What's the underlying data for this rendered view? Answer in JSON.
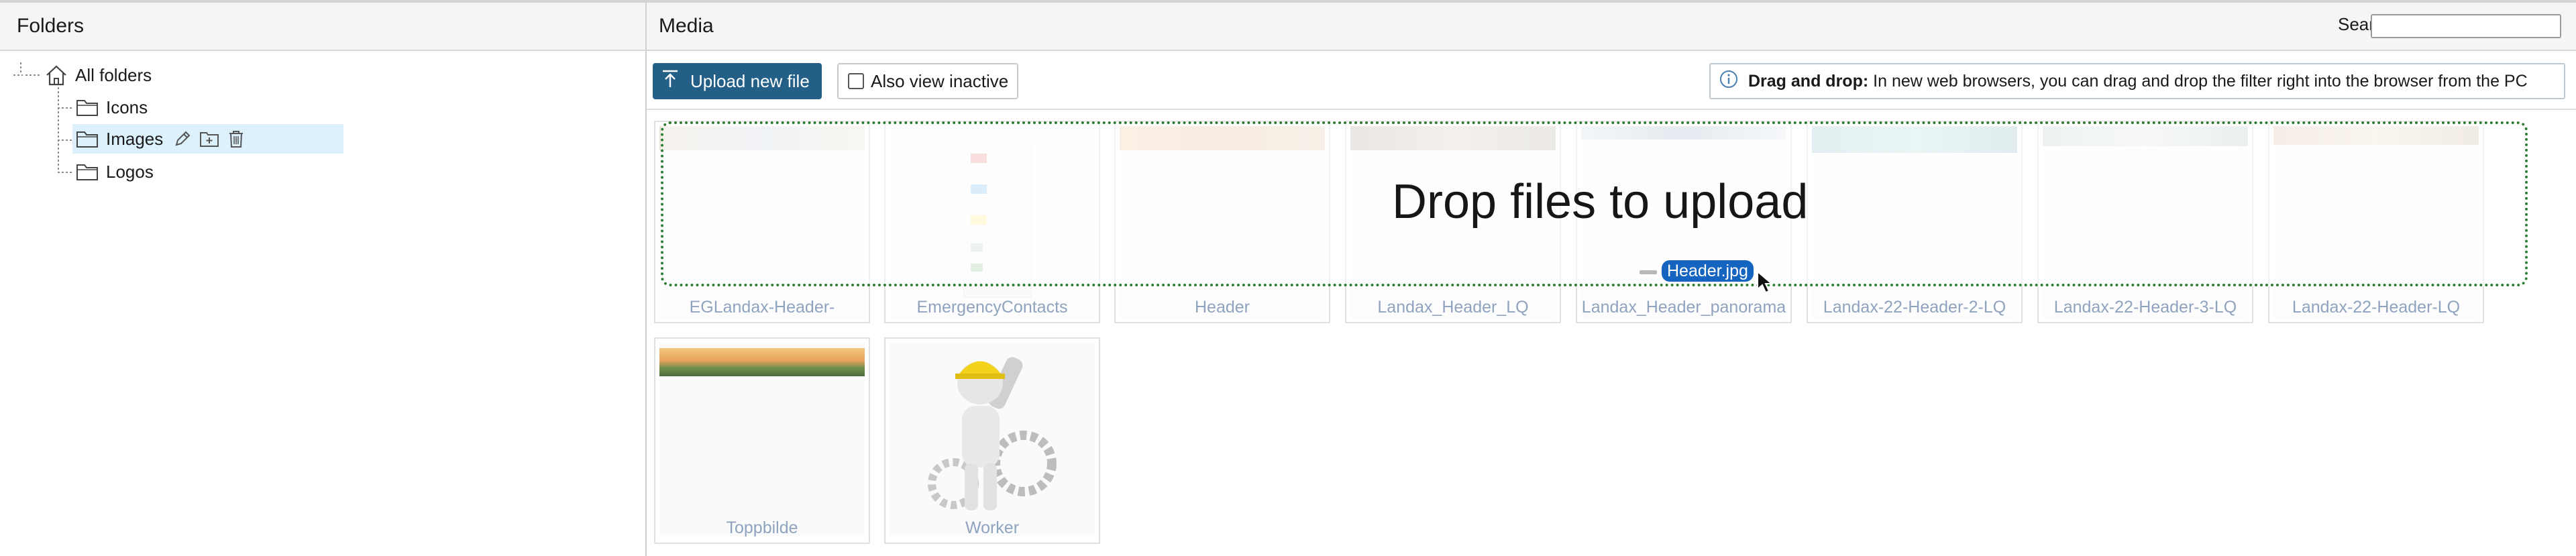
{
  "folders_panel": {
    "title": "Folders",
    "tree": [
      {
        "label": "All folders",
        "icon": "home-icon"
      },
      {
        "label": "Icons",
        "icon": "folder-icon"
      },
      {
        "label": "Images",
        "icon": "folder-icon",
        "selected": true,
        "actions": [
          "edit-icon",
          "add-folder-icon",
          "delete-icon"
        ]
      },
      {
        "label": "Logos",
        "icon": "folder-icon"
      }
    ]
  },
  "media_panel": {
    "title": "Media",
    "search": {
      "label": "Search",
      "value": "",
      "placeholder": ""
    },
    "toolbar": {
      "upload_label": "Upload new file",
      "inactive_label": "Also view inactive",
      "inactive_checked": false,
      "info_bold": "Drag and drop:",
      "info_text": "In new web browsers, you can drag and drop the filter right into the browser from the PC"
    },
    "dropzone": {
      "text": "Drop files to upload",
      "dragged_file": "Header.jpg"
    },
    "thumbnails": [
      {
        "caption": "EGLandax-Header-"
      },
      {
        "caption": "EmergencyContacts"
      },
      {
        "caption": "Header"
      },
      {
        "caption": "Landax_Header_LQ"
      },
      {
        "caption": "Landax_Header_panorama"
      },
      {
        "caption": "Landax-22-Header-2-LQ"
      },
      {
        "caption": "Landax-22-Header-3-LQ"
      },
      {
        "caption": "Landax-22-Header-LQ"
      },
      {
        "caption": "Toppbilde"
      },
      {
        "caption": "Worker"
      }
    ]
  },
  "colors": {
    "accent": "#245f87",
    "selection": "#dcf1fb",
    "dropzone_border": "#2e7d32",
    "drag_chip": "#1565c0",
    "caption": "#8fa3be"
  }
}
